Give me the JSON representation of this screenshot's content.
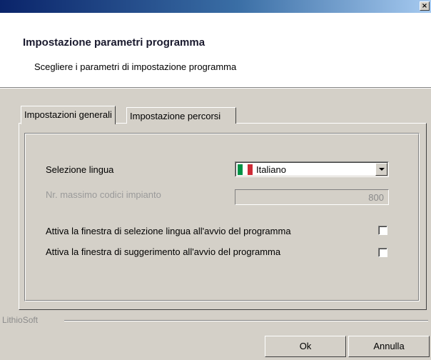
{
  "titlebar": {
    "close_label": "×"
  },
  "header": {
    "title": "Impostazione parametri programma",
    "subtitle": "Scegliere i parametri di impostazione programma"
  },
  "tabs": [
    {
      "label": "Impostazioni generali",
      "active": true
    },
    {
      "label": "Impostazione percorsi",
      "active": false
    }
  ],
  "form": {
    "language_label": "Selezione lingua",
    "language_value": "Italiano",
    "language_flag_colors": [
      "#009246",
      "#ffffff",
      "#ce2b37"
    ],
    "max_codes_label": "Nr. massimo codici impianto",
    "max_codes_value": "800",
    "checkbox1_label": "Attiva la finestra di selezione lingua all'avvio del programma",
    "checkbox1_checked": false,
    "checkbox2_label": "Attiva la finestra di suggerimento all'avvio del programma",
    "checkbox2_checked": false
  },
  "footer": {
    "brand": "LithioSoft",
    "ok_label": "Ok",
    "cancel_label": "Annulla"
  }
}
